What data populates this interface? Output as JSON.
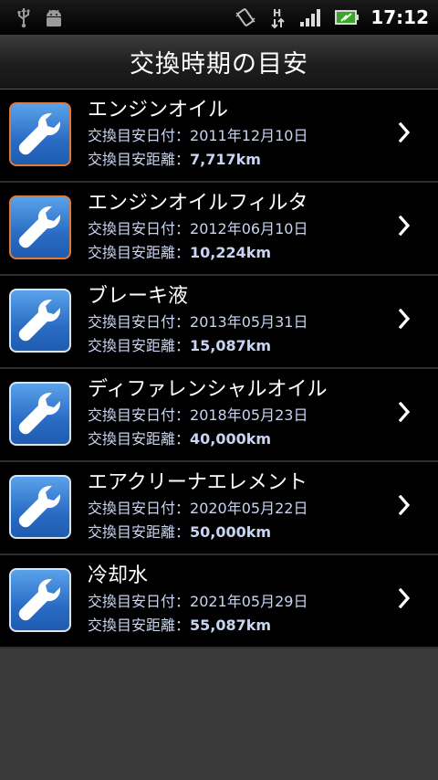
{
  "status_bar": {
    "time": "17:12",
    "icons": [
      "usb-icon",
      "android-debug-icon",
      "vibrate-icon",
      "hspa-data-icon",
      "signal-bars-icon",
      "battery-charging-icon"
    ],
    "network_label": "H"
  },
  "header": {
    "title": "交換時期の目安"
  },
  "labels": {
    "date_label": "交換目安日付：",
    "distance_label": "交換目安距離："
  },
  "items": [
    {
      "name": "エンジンオイル",
      "date": "2011年12月10日",
      "distance": "7,717km",
      "alert": true
    },
    {
      "name": "エンジンオイルフィルタ",
      "date": "2012年06月10日",
      "distance": "10,224km",
      "alert": true
    },
    {
      "name": "ブレーキ液",
      "date": "2013年05月31日",
      "distance": "15,087km",
      "alert": false
    },
    {
      "name": "ディファレンシャルオイル",
      "date": "2018年05月23日",
      "distance": "40,000km",
      "alert": false
    },
    {
      "name": "エアクリーナエレメント",
      "date": "2020年05月22日",
      "distance": "50,000km",
      "alert": false
    },
    {
      "name": "冷却水",
      "date": "2021年05月29日",
      "distance": "55,087km",
      "alert": false
    }
  ],
  "colors": {
    "alert_border": "#e07a3a",
    "icon_blue": "#2a6cc4",
    "detail_text": "#c9d4f2"
  }
}
